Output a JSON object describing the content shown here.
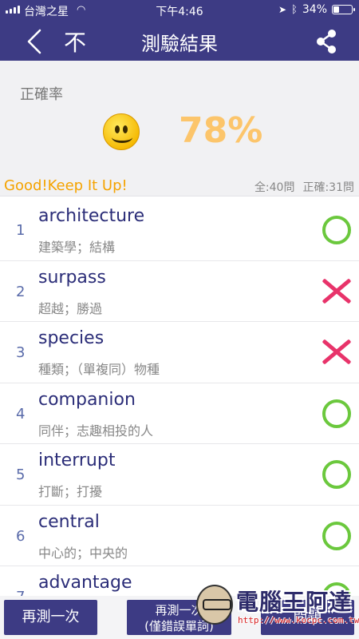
{
  "status_bar": {
    "carrier": "台灣之星",
    "time": "下午4:46",
    "battery": "34%",
    "battery_level": 0.34
  },
  "nav": {
    "back_icon": "chevron-left-icon",
    "secondary_label": "不",
    "title": "測驗結果",
    "share_icon": "share-icon"
  },
  "summary": {
    "label": "正確率",
    "smiley_icon": "smiley-icon",
    "percent": "78%",
    "message": "Good!Keep It Up!",
    "total": "全:40問",
    "correct": "正確:31問"
  },
  "results": [
    {
      "num": "1",
      "word": "architecture",
      "definition": "建築學；結構",
      "correct": true
    },
    {
      "num": "2",
      "word": "surpass",
      "definition": "超越；勝過",
      "correct": false
    },
    {
      "num": "3",
      "word": "species",
      "definition": "種類；（單複同）物種",
      "correct": false
    },
    {
      "num": "4",
      "word": "companion",
      "definition": "同伴；志趣相投的人",
      "correct": true
    },
    {
      "num": "5",
      "word": "interrupt",
      "definition": "打斷；打擾",
      "correct": true
    },
    {
      "num": "6",
      "word": "central",
      "definition": "中心的；中央的",
      "correct": true
    },
    {
      "num": "7",
      "word": "advantage",
      "definition": "",
      "correct": true
    }
  ],
  "buttons": {
    "retest": "再測一次",
    "retest_wrong_line1": "再測一次",
    "retest_wrong_line2": "(僅錯誤單詞)",
    "next": "問題"
  },
  "watermark": {
    "text": "電腦王阿達",
    "url": "http://www.kocpc.com.tw"
  },
  "colors": {
    "header": "#3d3b84",
    "percent": "#fcc56b",
    "message": "#f5a300",
    "correct": "#6bc83d",
    "wrong": "#e8336a"
  }
}
